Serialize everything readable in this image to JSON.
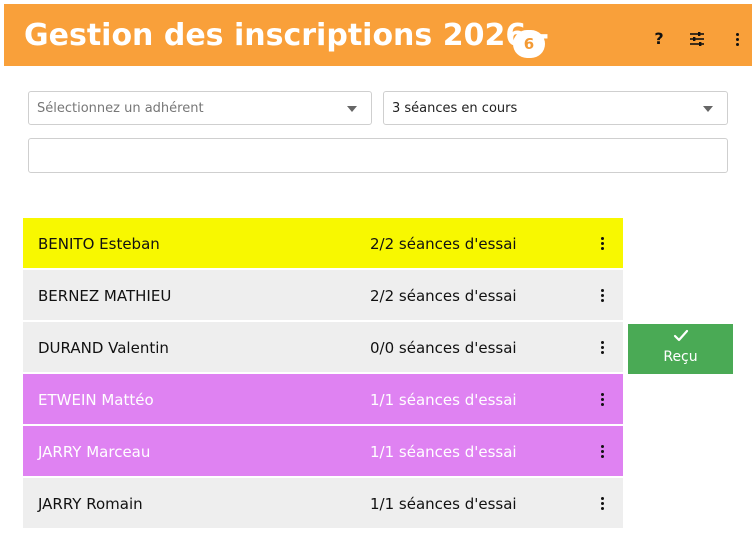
{
  "header": {
    "title": "Gestion des inscriptions 2026 -",
    "badge_count": "6",
    "help_label": "?",
    "icons": [
      "help-icon",
      "tune-icon",
      "more-vert-icon"
    ],
    "background_color": "#f9a03a"
  },
  "filters": {
    "member_select": {
      "value": "Sélectionnez un adhérent"
    },
    "sessions_select": {
      "value": "3 séances en cours"
    },
    "search": {
      "value": ""
    }
  },
  "rows": [
    {
      "name": "BENITO Esteban",
      "sessions": "2/2 séances d'essai",
      "highlight": "#f8f800"
    },
    {
      "name": "BERNEZ MATHIEU",
      "sessions": "2/2 séances d'essai",
      "highlight": "#eeeeee"
    },
    {
      "name": "DURAND Valentin",
      "sessions": "0/0 séances d'essai",
      "highlight": "#eeeeee"
    },
    {
      "name": "ETWEIN Mattéo",
      "sessions": "1/1 séances d'essai",
      "highlight": "#df82f2"
    },
    {
      "name": "JARRY Marceau",
      "sessions": "1/1 séances d'essai",
      "highlight": "#df82f2"
    },
    {
      "name": "JARRY Romain",
      "sessions": "1/1 séances d'essai",
      "highlight": "#eeeeee"
    }
  ],
  "recu_button": {
    "label": "Reçu",
    "icon": "check-icon",
    "color": "#4aaa55"
  }
}
